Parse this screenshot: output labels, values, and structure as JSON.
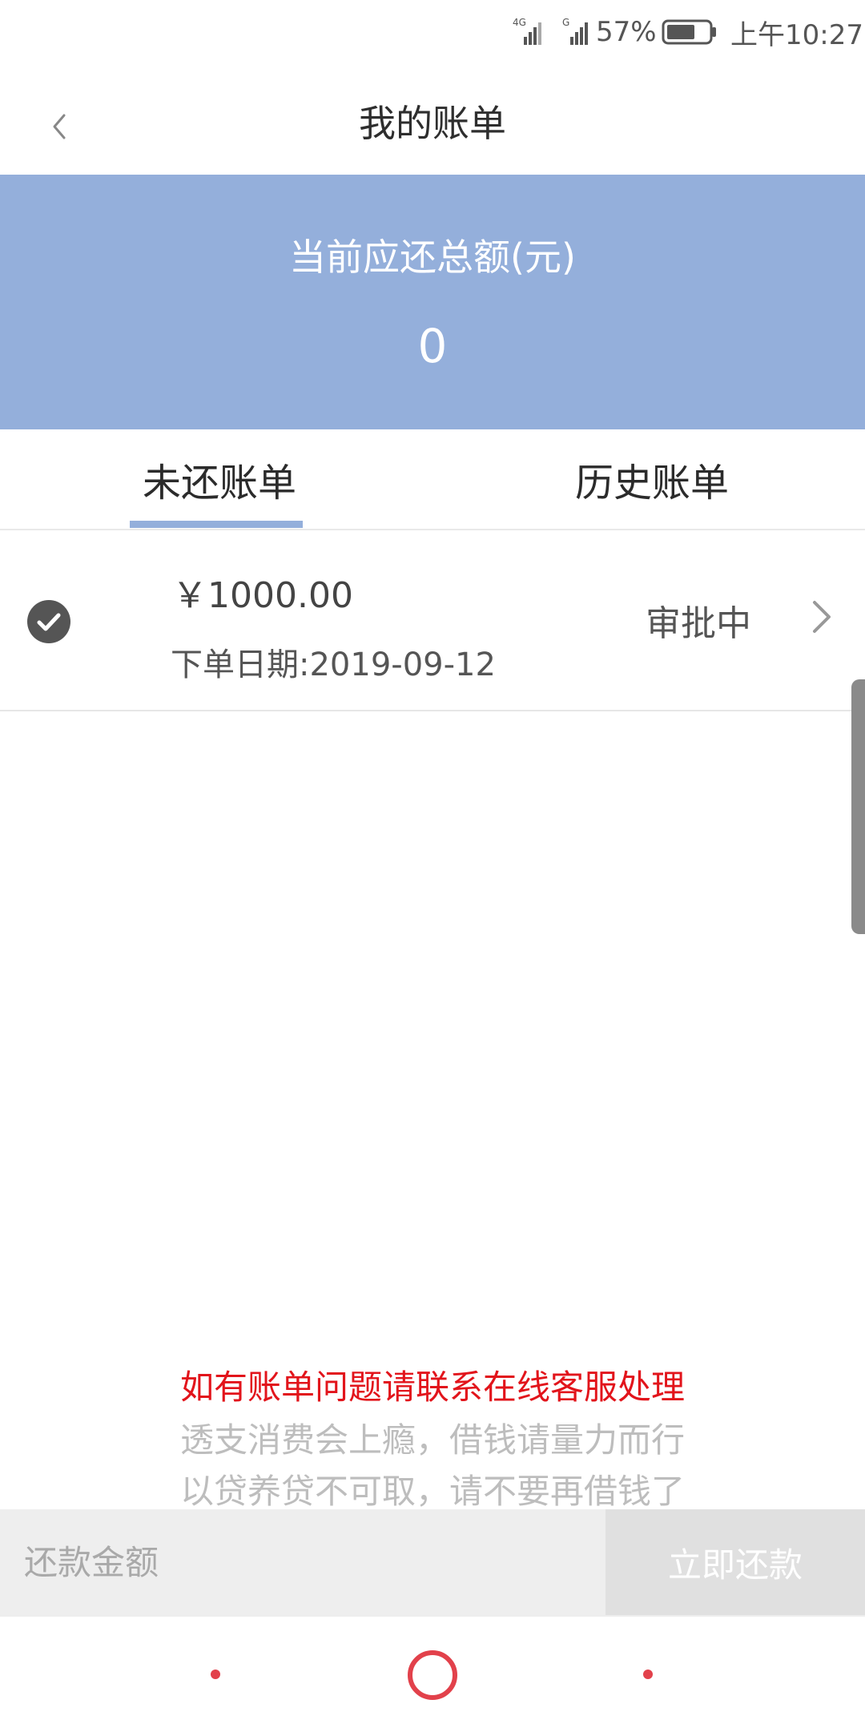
{
  "status_bar": {
    "network1": "4G",
    "network2": "G",
    "battery": "57%",
    "time": "上午10:27"
  },
  "header": {
    "title": "我的账单",
    "back_icon": "chevron-left-icon"
  },
  "summary": {
    "label": "当前应还总额(元)",
    "amount": "0"
  },
  "tabs": [
    {
      "label": "未还账单",
      "active": true
    },
    {
      "label": "历史账单",
      "active": false
    }
  ],
  "bills": [
    {
      "amount": "￥1000.00",
      "date": "下单日期:2019-09-12",
      "status": "审批中"
    }
  ],
  "notices": {
    "contact": "如有账单问题请联系在线客服处理",
    "warning1": "透支消费会上瘾，借钱请量力而行",
    "warning2": "以贷养贷不可取，请不要再借钱了"
  },
  "repay": {
    "placeholder": "还款金额",
    "button": "立即还款"
  },
  "colors": {
    "accent": "#94afdb",
    "notice_red": "#e2141b",
    "nav_red": "#e2414b"
  }
}
